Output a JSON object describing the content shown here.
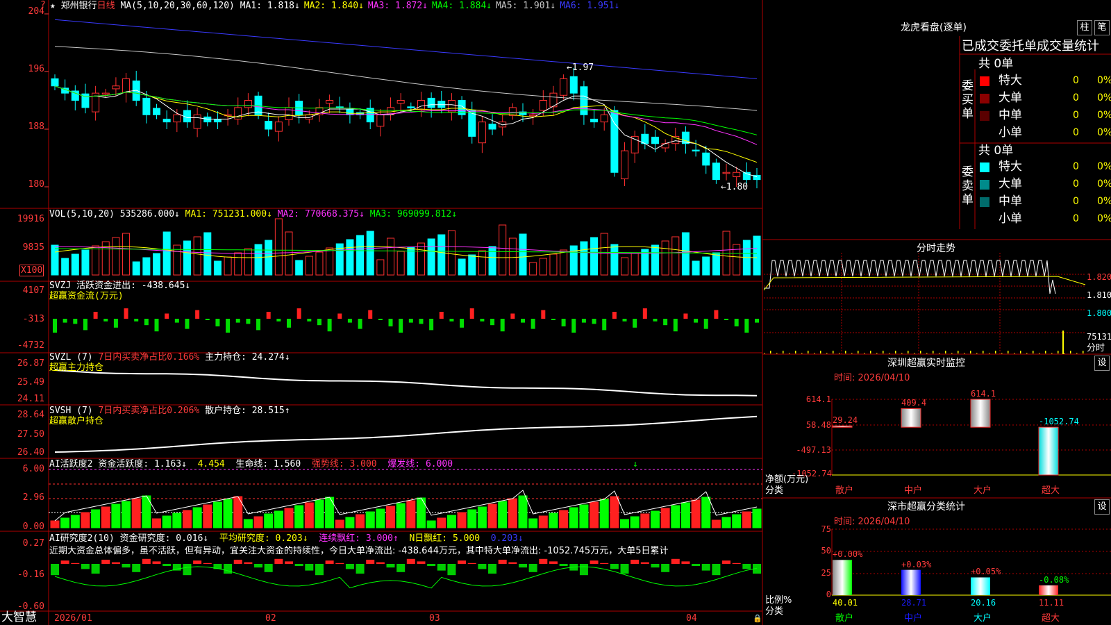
{
  "header": {
    "star": "★",
    "name": "郑州银行",
    "period": "日线",
    "ma_params": "MA(5,10,20,30,60,120)",
    "ma": [
      {
        "label": "MA1: 1.818↓",
        "color": "#ffffff"
      },
      {
        "label": "MA2: 1.840↓",
        "color": "#ffff00"
      },
      {
        "label": "MA3: 1.872↓",
        "color": "#ff33ff"
      },
      {
        "label": "MA4: 1.884↓",
        "color": "#00ff00"
      },
      {
        "label": "MA5: 1.901↓",
        "color": "#c8c8c8"
      },
      {
        "label": "MA6: 1.951↓",
        "color": "#3a3aff"
      }
    ]
  },
  "price_axis": [
    "204",
    "196",
    "188",
    "180"
  ],
  "annotations": {
    "high": "1.97",
    "low": "1.80"
  },
  "vol_panel": {
    "title": "VOL(5,10,20)",
    "value": "535286.000↓",
    "ma1": "MA1: 751231.000↓",
    "ma2": "MA2: 770668.375↓",
    "ma3": "MA3: 969099.812↓",
    "axis": [
      "19916",
      "9835"
    ],
    "unit": "X100"
  },
  "svzj_panel": {
    "title": "SVZJ",
    "label": "活跃资金进出: -438.645↓",
    "sub": "超赢资金流(万元)",
    "axis": [
      "4107",
      "-313",
      "-4732"
    ]
  },
  "svzl_panel": {
    "title": "SVZL (7)",
    "ratio": "7日内买卖净占比0.166%",
    "hold": "主力持仓: 24.274↓",
    "sub": "超赢主力持仓",
    "axis": [
      "26.87",
      "25.49",
      "24.11"
    ]
  },
  "svsh_panel": {
    "title": "SVSH (7)",
    "ratio": "7日内买卖净占比0.206%",
    "hold": "散户持仓: 28.515↑",
    "sub": "超赢散户持仓",
    "axis": [
      "28.64",
      "27.50",
      "26.40"
    ]
  },
  "ai_active": {
    "title": "AI活跃度2",
    "activity": "资金活跃度: 1.163↓",
    "val2": "4.454",
    "life": "生命线: 1.560",
    "strong": "强势线: 3.000",
    "burst": "爆发线: 6.000",
    "axis": [
      "6.00",
      "2.96",
      "0.00"
    ],
    "arrow": "↓"
  },
  "ai_research": {
    "title": "AI研究度2(10)",
    "research": "资金研究度: 0.016↓",
    "avg": "平均研究度: 0.203↓",
    "consec": "连续飘红: 3.000↑",
    "nday": "N日飘红: 5.000",
    "val": "0.203↓",
    "text": "近期大资金总体偏多，虽不活跃，但有异动，宜关注大资金的持续性，今日大单净流出: -438.644万元，其中特大单净流出: -1052.745万元，大单5日累计",
    "axis": [
      "0.27",
      "-0.16",
      "-0.60"
    ]
  },
  "date_axis": [
    "2026/01",
    "02",
    "03",
    "04"
  ],
  "brand": "大智慧",
  "right": {
    "dragon": {
      "title": "龙虎看盘(逐单)",
      "btn1": "柱",
      "btn2": "笔",
      "subtitle": "已成交委托单成交量统计",
      "buy": {
        "side": "委买单",
        "count": "共 0单",
        "rows": [
          {
            "label": "特大",
            "vol": "0",
            "pct": "0%",
            "color": "#ff0000"
          },
          {
            "label": "大单",
            "vol": "0",
            "pct": "0%",
            "color": "#8b0000"
          },
          {
            "label": "中单",
            "vol": "0",
            "pct": "0%",
            "color": "#5a0000"
          },
          {
            "label": "小单",
            "vol": "0",
            "pct": "0%",
            "color": "#000000"
          }
        ]
      },
      "sell": {
        "side": "委卖单",
        "count": "共 0单",
        "rows": [
          {
            "label": "特大",
            "vol": "0",
            "pct": "0%",
            "color": "#00ffff"
          },
          {
            "label": "大单",
            "vol": "0",
            "pct": "0%",
            "color": "#008b8b"
          },
          {
            "label": "中单",
            "vol": "0",
            "pct": "0%",
            "color": "#006b6b"
          },
          {
            "label": "小单",
            "vol": "0",
            "pct": "0%",
            "color": "#000000"
          }
        ]
      }
    },
    "intraday": {
      "title": "分时走势",
      "axis": [
        "1.820",
        "1.810",
        "1.800"
      ],
      "vol_label": "75131",
      "vol_unit": "分时"
    },
    "sz_monitor": {
      "title": "深圳超赢实时监控",
      "btn": "设",
      "time": "时间: 2026/04/10",
      "axis": [
        "614.1",
        "58.48",
        "-497.13",
        "-1052.74"
      ],
      "ylabel": "净额(万元)",
      "xlabel": "分类",
      "bars": [
        {
          "cat": "散户",
          "value": 29.24,
          "label": "29.24"
        },
        {
          "cat": "中户",
          "value": 409.4,
          "label": "409.4"
        },
        {
          "cat": "大户",
          "value": 614.1,
          "label": "614.1"
        },
        {
          "cat": "超大",
          "value": -1052.74,
          "label": "-1052.74"
        }
      ]
    },
    "sz_class": {
      "title": "深市超赢分类统计",
      "btn": "设",
      "time": "时间: 2026/04/10",
      "axis": [
        "75",
        "50",
        "25",
        "0"
      ],
      "ylabel": "比例%",
      "xlabel": "分类",
      "bars": [
        {
          "cat": "散户",
          "value": 40.01,
          "label": "40.01",
          "chg": "+0.00%"
        },
        {
          "cat": "中户",
          "value": 28.71,
          "label": "28.71",
          "chg": "+0.03%"
        },
        {
          "cat": "大户",
          "value": 20.16,
          "label": "20.16",
          "chg": "+0.05%"
        },
        {
          "cat": "超大",
          "value": 11.11,
          "label": "11.11",
          "chg": "-0.08%"
        }
      ]
    }
  },
  "chart_data": {
    "type": "candlestick",
    "title": "郑州银行 日线",
    "xlabel": "",
    "ylabel": "",
    "x_ticks": [
      "2026/01",
      "02",
      "03",
      "04"
    ],
    "ylim": [
      1.78,
      2.05
    ],
    "close": [
      1.94,
      1.93,
      1.92,
      1.91,
      1.93,
      1.93,
      1.94,
      1.95,
      1.92,
      1.9,
      1.9,
      1.89,
      1.9,
      1.89,
      1.9,
      1.89,
      1.89,
      1.9,
      1.91,
      1.92,
      1.9,
      1.88,
      1.89,
      1.91,
      1.9,
      1.9,
      1.91,
      1.92,
      1.91,
      1.9,
      1.9,
      1.89,
      1.9,
      1.91,
      1.92,
      1.91,
      1.92,
      1.91,
      1.91,
      1.92,
      1.9,
      1.87,
      1.89,
      1.88,
      1.89,
      1.91,
      1.9,
      1.9,
      1.92,
      1.93,
      1.95,
      1.93,
      1.9,
      1.89,
      1.9,
      1.82,
      1.85,
      1.87,
      1.86,
      1.86,
      1.86,
      1.87,
      1.86,
      1.85,
      1.83,
      1.81,
      1.82,
      1.82,
      1.81,
      1.81
    ]
  }
}
